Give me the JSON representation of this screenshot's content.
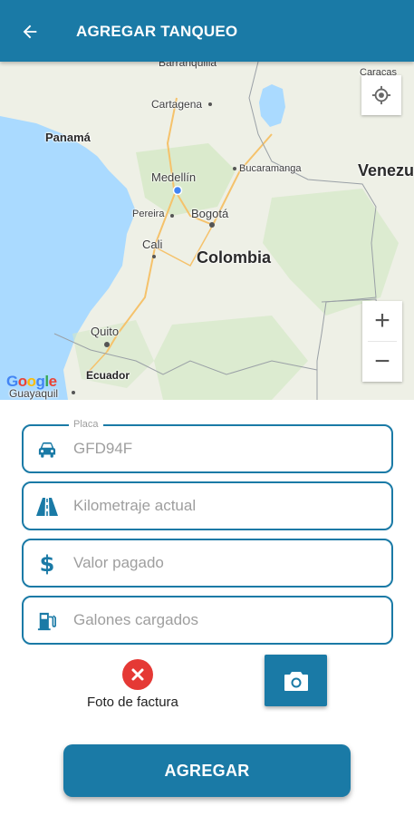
{
  "appbar": {
    "title": "AGREGAR TANQUEO",
    "back_icon": "arrow-back-icon"
  },
  "map": {
    "labels": {
      "barranquilla": "Barranquilla",
      "caracas": "Caracas",
      "cartagena": "Cartagena",
      "panama": "Panamá",
      "medellin": "Medellín",
      "bucaramanga": "Bucaramanga",
      "venezuela": "Venezu",
      "pereira": "Pereira",
      "bogota": "Bogotá",
      "cali": "Cali",
      "colombia": "Colombia",
      "quito": "Quito",
      "ecuador": "Ecuador",
      "guayaquil": "Guayaquil"
    },
    "google_logo": "Google",
    "zoom_in": "+",
    "zoom_out": "−",
    "locate_icon": "my-location-icon",
    "colors": {
      "water": "#aadaff",
      "land": "#eef0e6",
      "green": "#d4e8c6"
    }
  },
  "form": {
    "placa": {
      "label": "Placa",
      "value": "GFD94F",
      "icon": "car-icon"
    },
    "kilometraje": {
      "placeholder": "Kilometraje actual",
      "icon": "road-icon"
    },
    "valor": {
      "placeholder": "Valor pagado",
      "icon": "dollar-icon"
    },
    "galones": {
      "placeholder": "Galones cargados",
      "icon": "gas-station-icon"
    }
  },
  "photo": {
    "label": "Foto de factura",
    "status_icon": "error-close-icon",
    "camera_icon": "camera-icon"
  },
  "submit_label": "AGREGAR",
  "colors": {
    "primary": "#1a7aa6",
    "error": "#e53935"
  }
}
